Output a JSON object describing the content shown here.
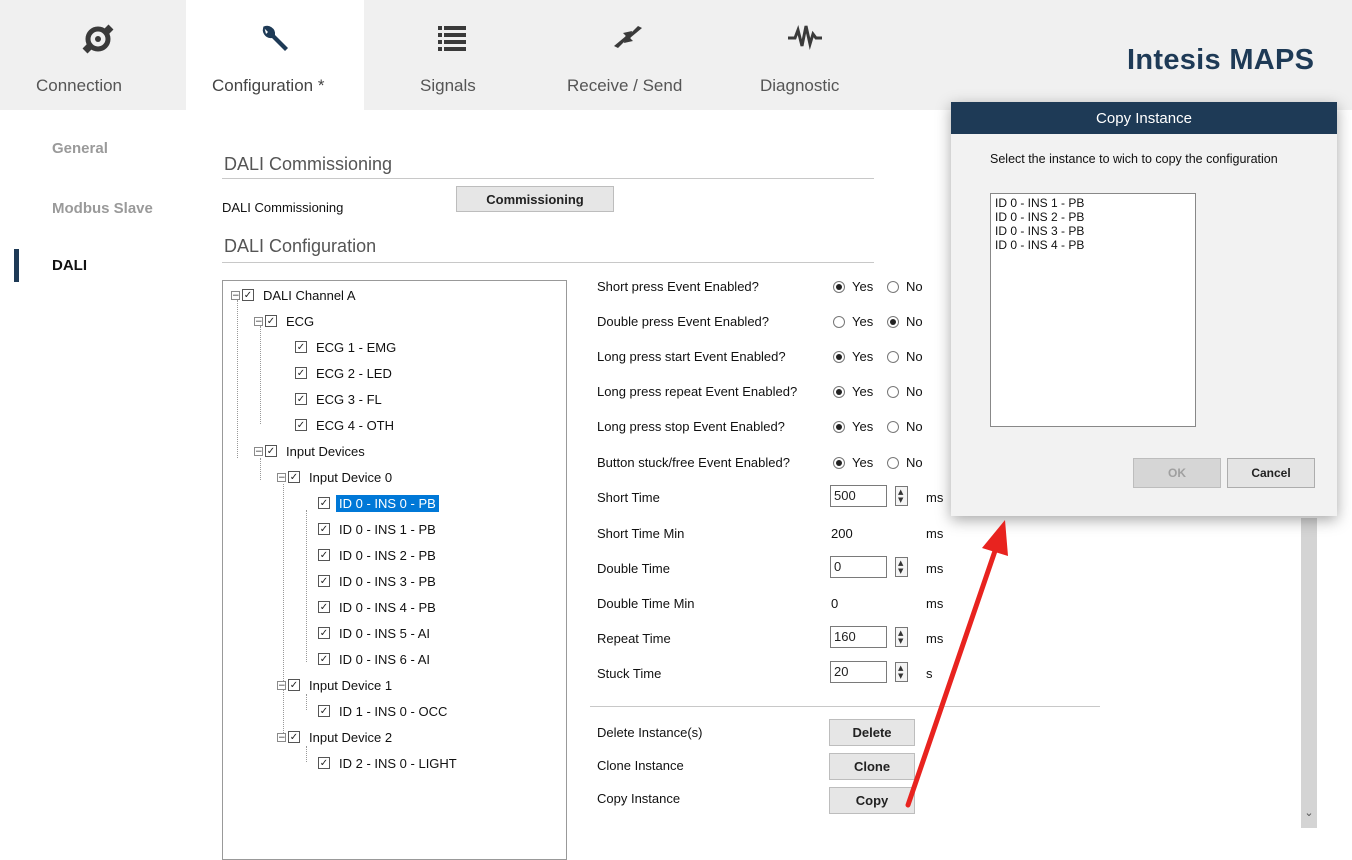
{
  "app": {
    "brand": "Intesis MAPS"
  },
  "tabs": [
    {
      "label": "Connection",
      "icon": "connection-plug-icon"
    },
    {
      "label": "Configuration *",
      "icon": "wrench-icon"
    },
    {
      "label": "Signals",
      "icon": "list-icon"
    },
    {
      "label": "Receive / Send",
      "icon": "transfer-arrows-icon"
    },
    {
      "label": "Diagnostic",
      "icon": "pulse-icon"
    }
  ],
  "active_tab": "Configuration *",
  "sidebar": {
    "items": [
      {
        "label": "General"
      },
      {
        "label": "Modbus Slave"
      },
      {
        "label": "DALI"
      }
    ],
    "active": "DALI"
  },
  "commissioning": {
    "section_title": "DALI Commissioning",
    "row_label": "DALI Commissioning",
    "button_label": "Commissioning"
  },
  "configuration": {
    "section_title": "DALI Configuration"
  },
  "tree": {
    "channel": "DALI Channel A",
    "ecg_group": "ECG",
    "ecg_items": [
      "ECG 1 - EMG",
      "ECG 2 - LED",
      "ECG 3 - FL",
      "ECG 4 - OTH"
    ],
    "input_group": "Input Devices",
    "device0": "Input Device 0",
    "device0_items": [
      "ID 0 - INS 0 - PB",
      "ID 0 - INS 1 - PB",
      "ID 0 - INS 2 - PB",
      "ID 0 - INS 3 - PB",
      "ID 0 - INS 4 - PB",
      "ID 0 - INS 5 - AI",
      "ID 0 - INS 6 - AI"
    ],
    "device1": "Input Device 1",
    "device1_items": [
      "ID 1 - INS 0 - OCC"
    ],
    "device2": "Input Device 2",
    "device2_items": [
      "ID 2 - INS 0 - LIGHT"
    ],
    "selected": "ID 0 - INS 0 - PB"
  },
  "properties": {
    "yes_label": "Yes",
    "no_label": "No",
    "events": [
      {
        "label": "Short press Event Enabled?",
        "value": "Yes"
      },
      {
        "label": "Double press Event Enabled?",
        "value": "No"
      },
      {
        "label": "Long press start Event Enabled?",
        "value": "Yes"
      },
      {
        "label": "Long press repeat Event Enabled?",
        "value": "Yes"
      },
      {
        "label": "Long press stop Event Enabled?",
        "value": "Yes"
      },
      {
        "label": "Button stuck/free Event Enabled?",
        "value": "Yes"
      }
    ],
    "times": [
      {
        "label": "Short Time",
        "value": "500",
        "unit": "ms",
        "editable": true
      },
      {
        "label": "Short Time Min",
        "value": "200",
        "unit": "ms",
        "editable": false
      },
      {
        "label": "Double Time",
        "value": "0",
        "unit": "ms",
        "editable": true
      },
      {
        "label": "Double Time Min",
        "value": "0",
        "unit": "ms",
        "editable": false
      },
      {
        "label": "Repeat Time",
        "value": "160",
        "unit": "ms",
        "editable": true
      },
      {
        "label": "Stuck Time",
        "value": "20",
        "unit": "s",
        "editable": true
      }
    ]
  },
  "actions": [
    {
      "label": "Delete Instance(s)",
      "button": "Delete"
    },
    {
      "label": "Clone Instance",
      "button": "Clone"
    },
    {
      "label": "Copy Instance",
      "button": "Copy"
    }
  ],
  "dialog": {
    "title": "Copy Instance",
    "message": "Select the instance to wich to copy the configuration",
    "items": [
      "ID 0 - INS 1 - PB",
      "ID 0 - INS 2 - PB",
      "ID 0 - INS 3 - PB",
      "ID 0 - INS 4 - PB"
    ],
    "ok_label": "OK",
    "cancel_label": "Cancel"
  },
  "colors": {
    "brand": "#1e3a56",
    "selection": "#0078d7",
    "annotation_arrow": "#e8231f"
  }
}
